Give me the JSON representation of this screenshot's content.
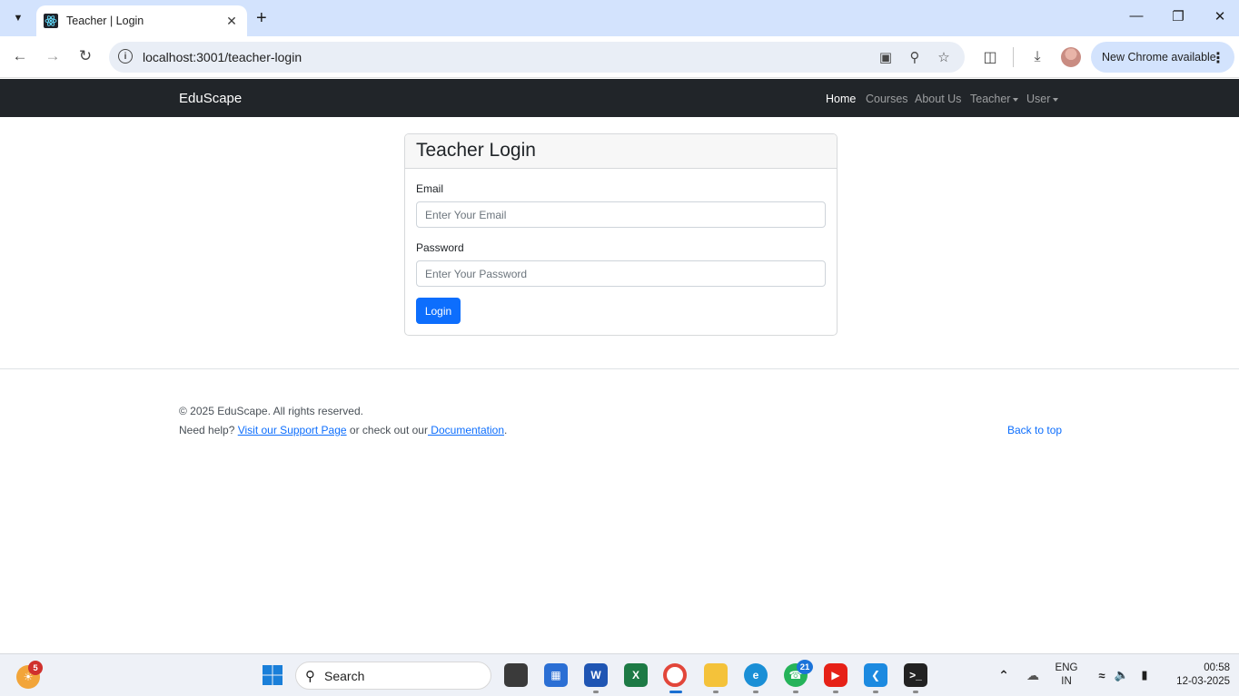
{
  "browser": {
    "tab_title": "Teacher | Login",
    "url": "localhost:3001/teacher-login",
    "update_label": "New Chrome available"
  },
  "navbar": {
    "brand": "EduScape",
    "links": [
      "Home",
      "Courses",
      "About Us",
      "Teacher",
      "User"
    ],
    "active": "Home"
  },
  "login": {
    "title": "Teacher Login",
    "email_label": "Email",
    "email_placeholder": "Enter Your Email",
    "password_label": "Password",
    "password_placeholder": "Enter Your Password",
    "button_label": "Login"
  },
  "footer": {
    "copyright": "© 2025 EduScape. All rights reserved.",
    "help_prefix": "Need help? ",
    "support_link": "Visit our Support Page",
    "middle_text": " or check out our",
    "docs_link": " Documentation",
    "suffix": ".",
    "back_to_top": "Back to top"
  },
  "taskbar": {
    "search_label": "Search",
    "widgets_badge": "5",
    "whatsapp_badge": "21",
    "lang_top": "ENG",
    "lang_bottom": "IN",
    "time": "00:58",
    "date": "12-03-2025"
  },
  "colors": {
    "navbar_bg": "#212529",
    "primary": "#0d6efd",
    "chrome_frame": "#d3e3fd"
  }
}
